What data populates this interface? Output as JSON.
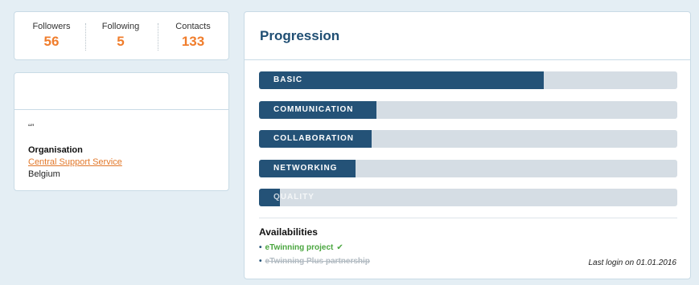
{
  "stats": {
    "followers_label": "Followers",
    "followers_value": "56",
    "following_label": "Following",
    "following_value": "5",
    "contacts_label": "Contacts",
    "contacts_value": "133"
  },
  "profile": {
    "quote": "“”",
    "organisation_label": "Organisation",
    "organisation_name": "Central Support Service",
    "country": "Belgium"
  },
  "progression": {
    "title": "Progression",
    "items": [
      {
        "label": "BASIC",
        "fraction": 0.68
      },
      {
        "label": "COMMUNICATION",
        "fraction": 0.28
      },
      {
        "label": "COLLABORATION",
        "fraction": 0.27
      },
      {
        "label": "NETWORKING",
        "fraction": 0.23
      },
      {
        "label": "QUALITY",
        "fraction": 0.05
      }
    ]
  },
  "availabilities": {
    "title": "Availabilities",
    "items": [
      {
        "label": "eTwinning project",
        "active": true,
        "icon": "check-icon"
      },
      {
        "label": "eTwinning Plus partnership",
        "active": false
      }
    ]
  },
  "last_login": "Last login on 01.01.2016",
  "colors": {
    "accent": "#f07d2c",
    "bar_fill": "#245277",
    "bar_track": "#d5dde4",
    "active_green": "#4aa63f"
  }
}
